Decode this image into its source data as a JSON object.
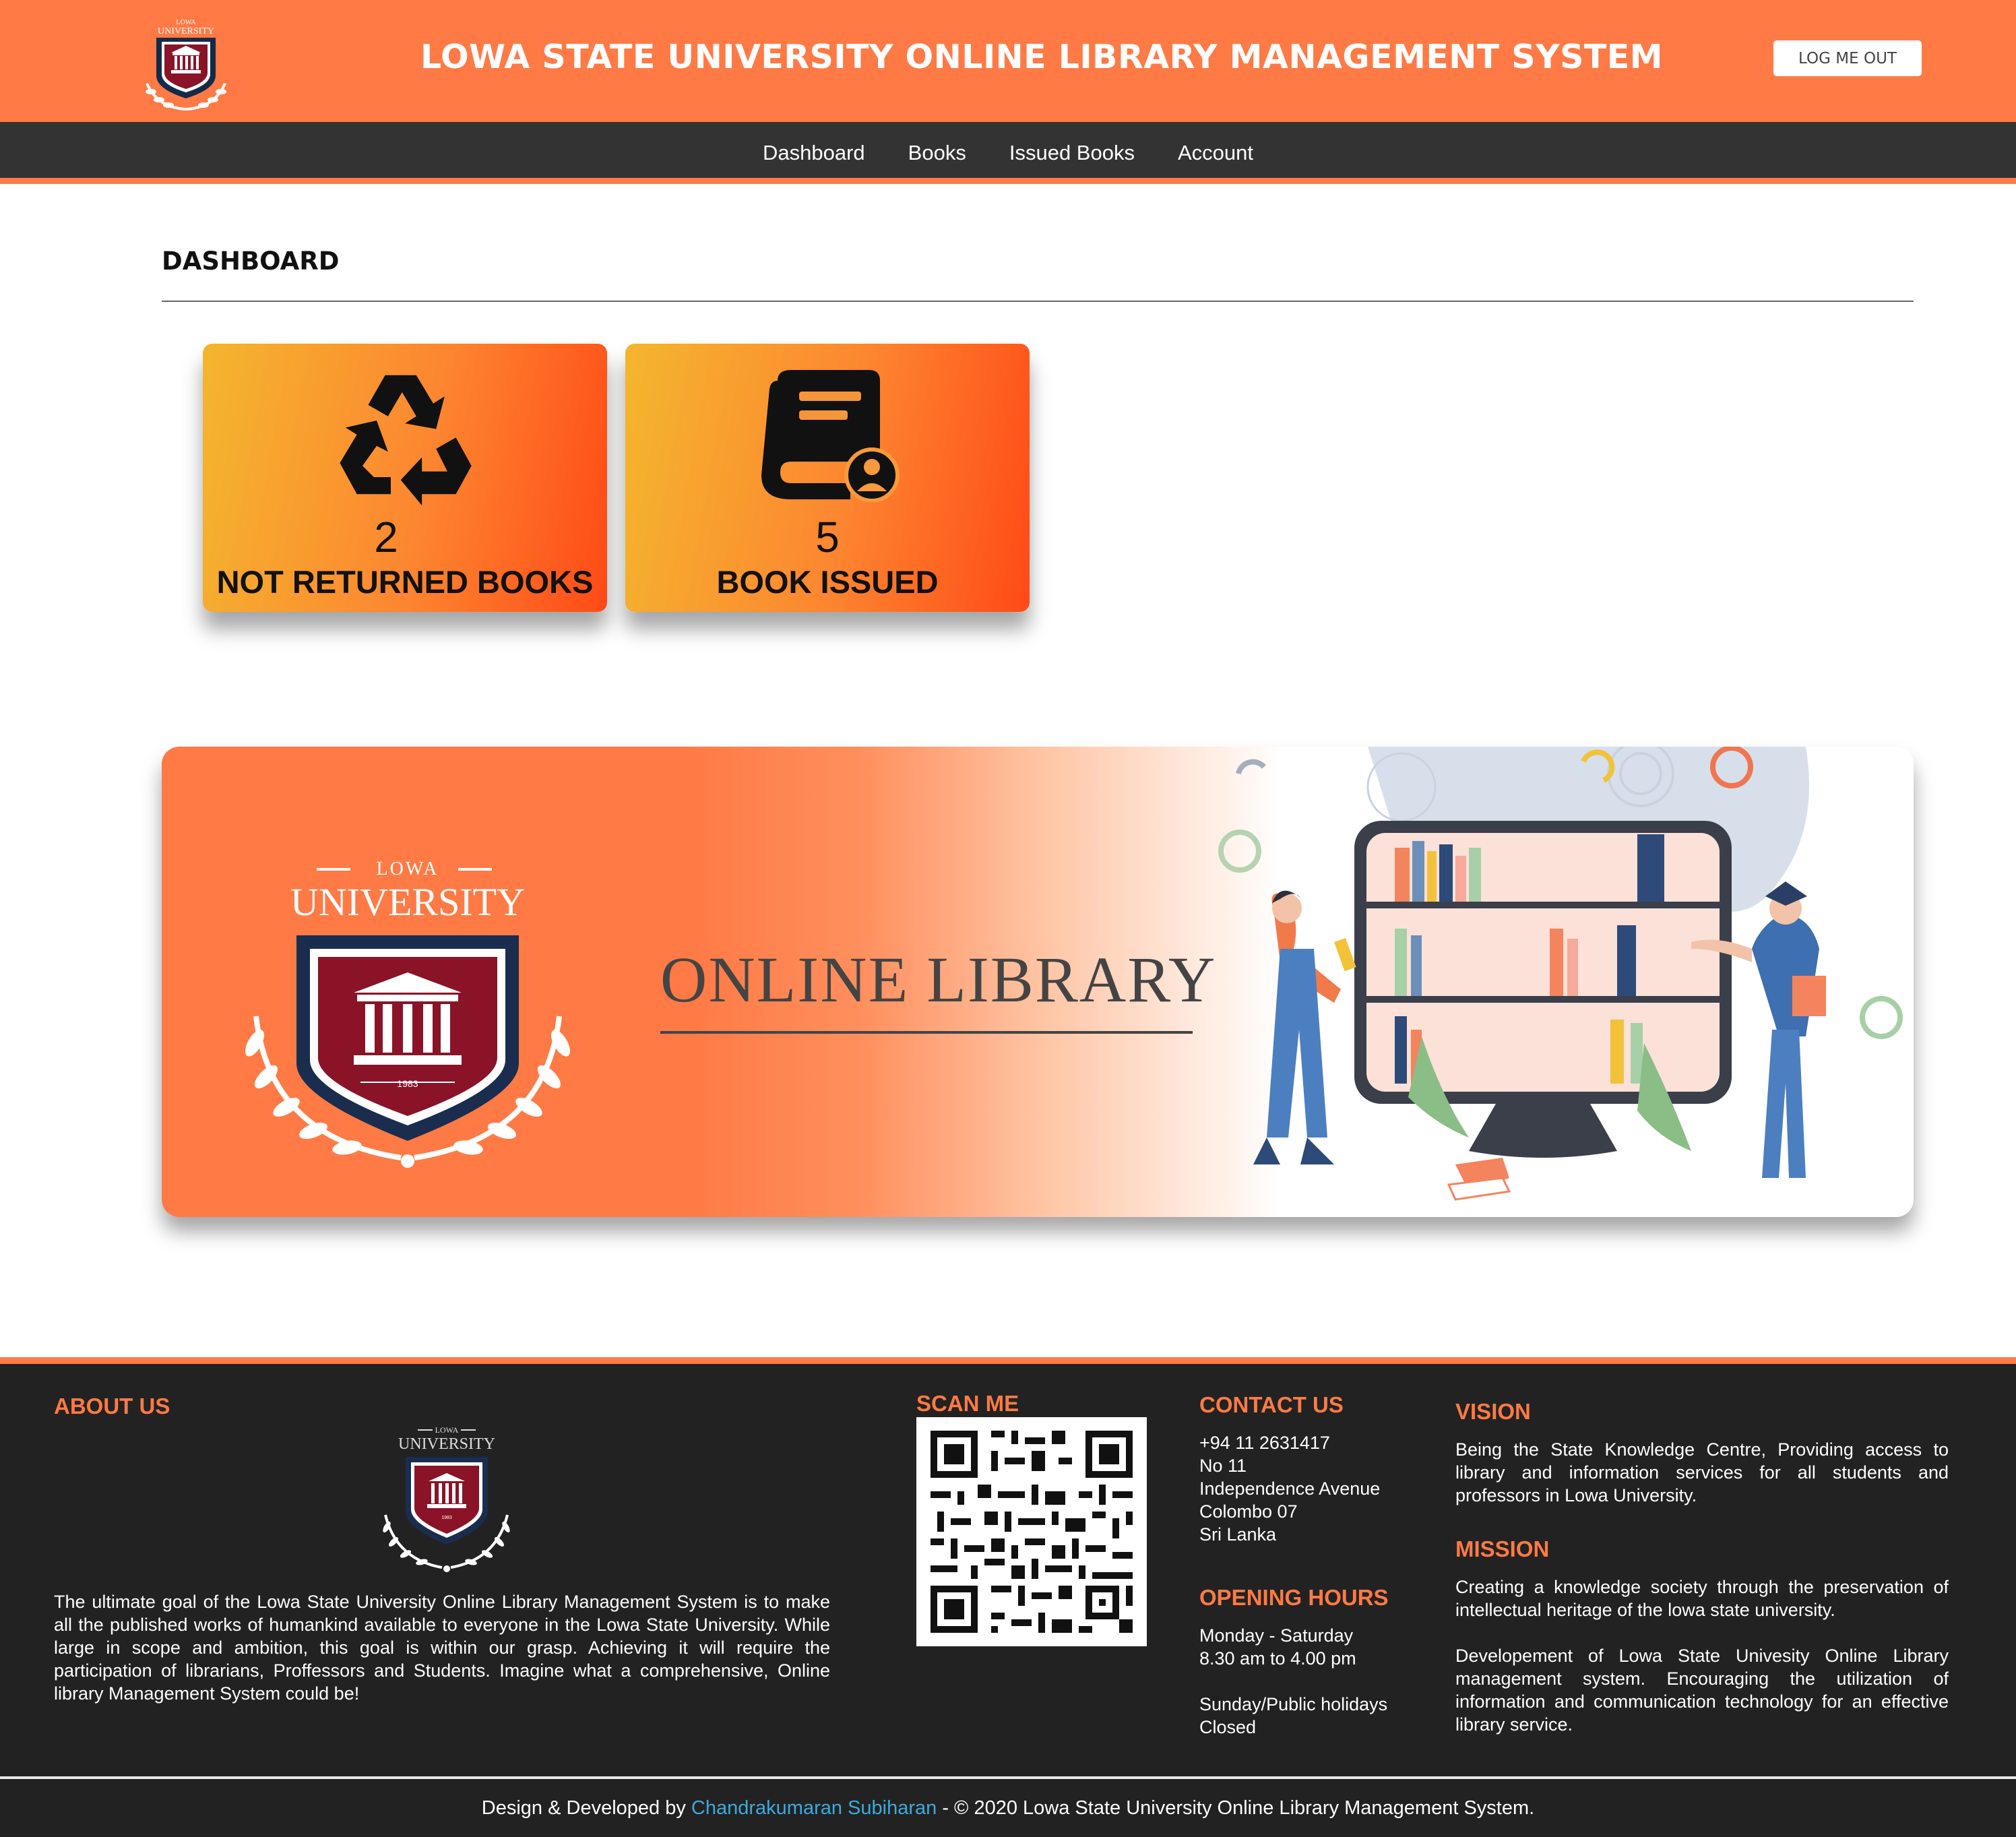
{
  "header": {
    "logo_top": "LOWA",
    "logo_name": "UNIVERSITY",
    "title": "LOWA STATE UNIVERSITY ONLINE LIBRARY MANAGEMENT SYSTEM",
    "logout_label": "LOG ME OUT"
  },
  "nav": {
    "items": [
      "Dashboard",
      "Books",
      "Issued Books",
      "Account"
    ]
  },
  "page": {
    "title": "DASHBOARD"
  },
  "cards": [
    {
      "icon": "recycle-icon",
      "count": "2",
      "label": "NOT RETURNED BOOKS"
    },
    {
      "icon": "book-user-icon",
      "count": "5",
      "label": "BOOK ISSUED"
    }
  ],
  "banner": {
    "logo_top": "LOWA",
    "logo_name": "UNIVERSITY",
    "logo_year": "1983",
    "title": "ONLINE LIBRARY"
  },
  "footer": {
    "about": {
      "heading": "ABOUT US",
      "logo_top": "LOWA",
      "logo_name": "UNIVERSITY",
      "logo_year": "1983",
      "text": "The ultimate goal of the Lowa State University Online Library Management System is to make all the published works of humankind available to everyone in the Lowa State University. While large in scope and ambition, this goal is within our grasp. Achieving it will require the participation of librarians, Proffessors and Students. Imagine what a comprehensive, Online library Management System could be!"
    },
    "scan": {
      "heading": "SCAN ME"
    },
    "contact": {
      "heading": "CONTACT US",
      "lines": [
        "+94 11 2631417",
        "No 11",
        "Independence Avenue",
        "Colombo 07",
        "Sri Lanka"
      ]
    },
    "hours": {
      "heading": "OPENING HOURS",
      "days": "Monday - Saturday",
      "time": "8.30 am to 4.00 pm",
      "holiday": "Sunday/Public holidays",
      "holiday_status": "Closed"
    },
    "vision": {
      "heading": "VISION",
      "text": "Being the State Knowledge Centre, Providing access to library and information services for all students and professors in Lowa University."
    },
    "mission": {
      "heading": "MISSION",
      "text1": "Creating a knowledge society through the preservation of intellectual heritage of the lowa state university.",
      "text2": "Developement of Lowa State Univesity Online Library management system. Encouraging the utilization of information and communication technology for an effective library service."
    },
    "credits": {
      "prefix": "Design & Developed by",
      "developer": "Chandrakumaran Subiharan",
      "suffix": "- © 2020 Lowa State University Online Library Management System."
    }
  },
  "colors": {
    "accent": "#ff7a45",
    "navbar": "#333333",
    "footer": "#222222",
    "crest": "#8a1328",
    "link": "#3fa9dc"
  }
}
